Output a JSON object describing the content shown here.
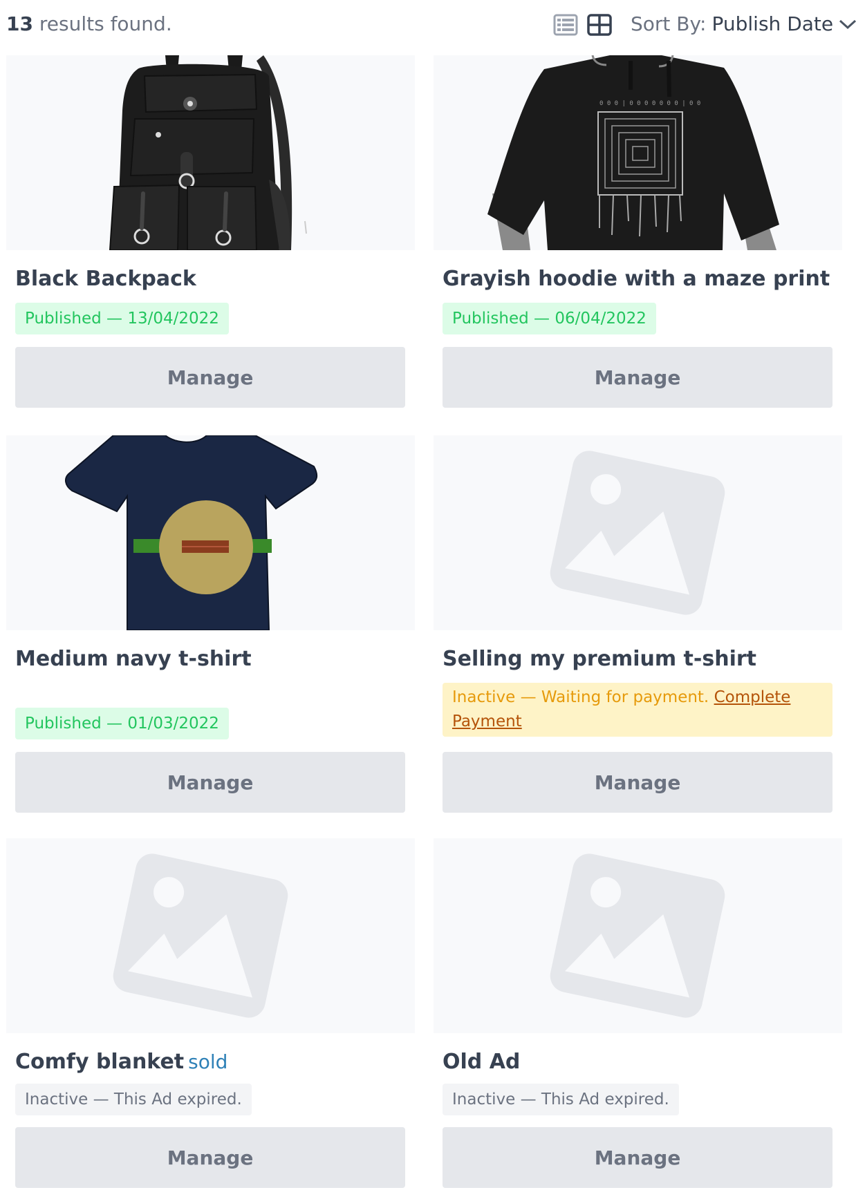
{
  "toolbar": {
    "results_count": "13",
    "results_suffix": " results found.",
    "sort_label": "Sort By:",
    "sort_value": "Publish Date",
    "icons": [
      "list-view-icon",
      "grid-view-icon",
      "chevron-down-icon"
    ]
  },
  "colors": {
    "published_bg": "#dcfce7",
    "published_text": "#22c55e",
    "pending_bg": "#fef3c7",
    "pending_text": "#e69a0b",
    "expired_bg": "#f3f4f6",
    "expired_text": "#6b7280",
    "button_bg": "#e5e7eb",
    "sold_text": "#2f81b7"
  },
  "ads": [
    {
      "title": "Black Backpack",
      "status": "Published — 13/04/2022",
      "image": "backpack-image",
      "manage_label": "Manage"
    },
    {
      "title": "Grayish hoodie with a maze print",
      "status": "Published — 06/04/2022",
      "image": "hoodie-image",
      "manage_label": "Manage"
    },
    {
      "title": "Medium navy t-shirt",
      "status": "Published — 01/03/2022",
      "image": "tshirt-image",
      "manage_label": "Manage"
    },
    {
      "title": "Selling my premium t-shirt",
      "status": "Inactive — Waiting for payment.",
      "status_link": "Complete Payment",
      "image": "placeholder-image-icon",
      "manage_label": "Manage"
    },
    {
      "title": "Comfy blanket",
      "sold_label": "sold",
      "status": "Inactive — This Ad expired.",
      "image": "placeholder-image-icon",
      "manage_label": "Manage"
    },
    {
      "title": "Old Ad",
      "status": "Inactive — This Ad expired.",
      "image": "placeholder-image-icon",
      "manage_label": "Manage"
    }
  ]
}
